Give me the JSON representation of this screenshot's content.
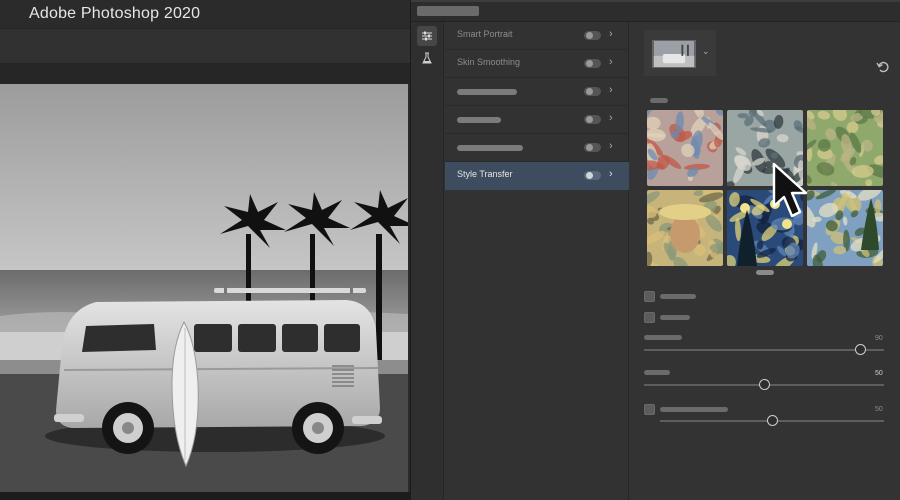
{
  "app": {
    "title": "Adobe Photoshop 2020"
  },
  "filters": [
    {
      "label": "Smart Portrait",
      "enabled": false,
      "active": false
    },
    {
      "label": "Skin Smoothing",
      "enabled": false,
      "active": false
    },
    {
      "label": "",
      "enabled": false,
      "active": false
    },
    {
      "label": "",
      "enabled": false,
      "active": false
    },
    {
      "label": "",
      "enabled": false,
      "active": false
    },
    {
      "label": "Style Transfer",
      "enabled": false,
      "active": true
    }
  ],
  "styles": [
    {
      "name": "abstract-composition",
      "colors": [
        "#b7a19a",
        "#6e8bb0",
        "#c05a4a",
        "#e0d2b8"
      ]
    },
    {
      "name": "cubist-abstract",
      "colors": [
        "#9aa6a4",
        "#d8d6cf",
        "#5c6f79",
        "#2f3b3f"
      ]
    },
    {
      "name": "landscape-village",
      "colors": [
        "#8fa86b",
        "#d6cc8e",
        "#5b7a47",
        "#b9b484"
      ]
    },
    {
      "name": "van-gogh-self-portrait",
      "colors": [
        "#c6b47a",
        "#8a9a7a",
        "#d9c07a",
        "#6c6a4a"
      ]
    },
    {
      "name": "starry-night",
      "colors": [
        "#2a4a7a",
        "#5f86b8",
        "#e0d37a",
        "#142340"
      ]
    },
    {
      "name": "wheat-field-cypresses",
      "colors": [
        "#7fa0c0",
        "#cfc277",
        "#3f5e3a",
        "#e4e0c6"
      ]
    }
  ],
  "sliders": [
    {
      "value": "90",
      "fraction": 0.9,
      "bright": false
    },
    {
      "value": "50",
      "fraction": 0.5,
      "bright": true
    },
    {
      "value": "50",
      "fraction": 0.5,
      "bright": false
    }
  ],
  "icons": {
    "tools": [
      "sliders-icon",
      "beaker-icon"
    ],
    "reset": "undo-icon",
    "cursor": "mouse-pointer-icon"
  },
  "colors": {
    "panel": "#333333",
    "active_row": "#3d4c5e",
    "app_background": "#2b2b2b"
  }
}
